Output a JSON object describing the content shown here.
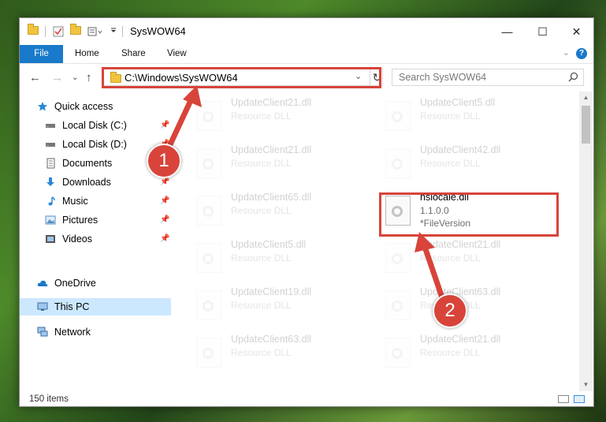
{
  "window": {
    "title": "SysWOW64",
    "controls": {
      "minimize": "—",
      "maximize": "☐",
      "close": "✕"
    }
  },
  "ribbon": {
    "tabs": [
      "File",
      "Home",
      "Share",
      "View"
    ],
    "help": "?"
  },
  "nav": {
    "address": "C:\\Windows\\SysWOW64",
    "search_placeholder": "Search SysWOW64"
  },
  "sidebar": {
    "items": [
      {
        "label": "Quick access",
        "icon": "star-icon"
      },
      {
        "label": "Local Disk (C:)",
        "icon": "drive-icon",
        "pinned": true
      },
      {
        "label": "Local Disk (D:)",
        "icon": "drive-icon",
        "pinned": true
      },
      {
        "label": "Documents",
        "icon": "documents-icon",
        "pinned": true
      },
      {
        "label": "Downloads",
        "icon": "download-icon",
        "pinned": true
      },
      {
        "label": "Music",
        "icon": "music-icon",
        "pinned": true
      },
      {
        "label": "Pictures",
        "icon": "pictures-icon",
        "pinned": true
      },
      {
        "label": "Videos",
        "icon": "videos-icon",
        "pinned": true
      },
      {
        "label": "OneDrive",
        "icon": "cloud-icon"
      },
      {
        "label": "This PC",
        "icon": "computer-icon",
        "selected": true
      },
      {
        "label": "Network",
        "icon": "network-icon"
      }
    ]
  },
  "files": [
    {
      "name": "UpdateClient21.dll",
      "line1": "Resource DLL",
      "line2": ""
    },
    {
      "name": "UpdateClient5.dll",
      "line1": "Resource DLL",
      "line2": ""
    },
    {
      "name": "UpdateClient21.dll",
      "line1": "Resource DLL",
      "line2": ""
    },
    {
      "name": "UpdateClient42.dll",
      "line1": "Resource DLL",
      "line2": ""
    },
    {
      "name": "UpdateClient65.dll",
      "line1": "Resource DLL",
      "line2": ""
    },
    {
      "name": "nslocale.dll",
      "line1": "1.1.0.0",
      "line2": "*FileVersion",
      "highlight": true
    },
    {
      "name": "UpdateClient5.dll",
      "line1": "Resource DLL",
      "line2": ""
    },
    {
      "name": "UpdateClient21.dll",
      "line1": "Resource DLL",
      "line2": ""
    },
    {
      "name": "UpdateClient19.dll",
      "line1": "Resource DLL",
      "line2": ""
    },
    {
      "name": "UpdateClient63.dll",
      "line1": "Resource DLL",
      "line2": ""
    },
    {
      "name": "UpdateClient63.dll",
      "line1": "Resource DLL",
      "line2": ""
    },
    {
      "name": "UpdateClient21.dll",
      "line1": "Resource DLL",
      "line2": ""
    }
  ],
  "status": {
    "items": "150 items"
  },
  "annotations": {
    "badge1": "1",
    "badge2": "2",
    "color": "#d8443a"
  }
}
